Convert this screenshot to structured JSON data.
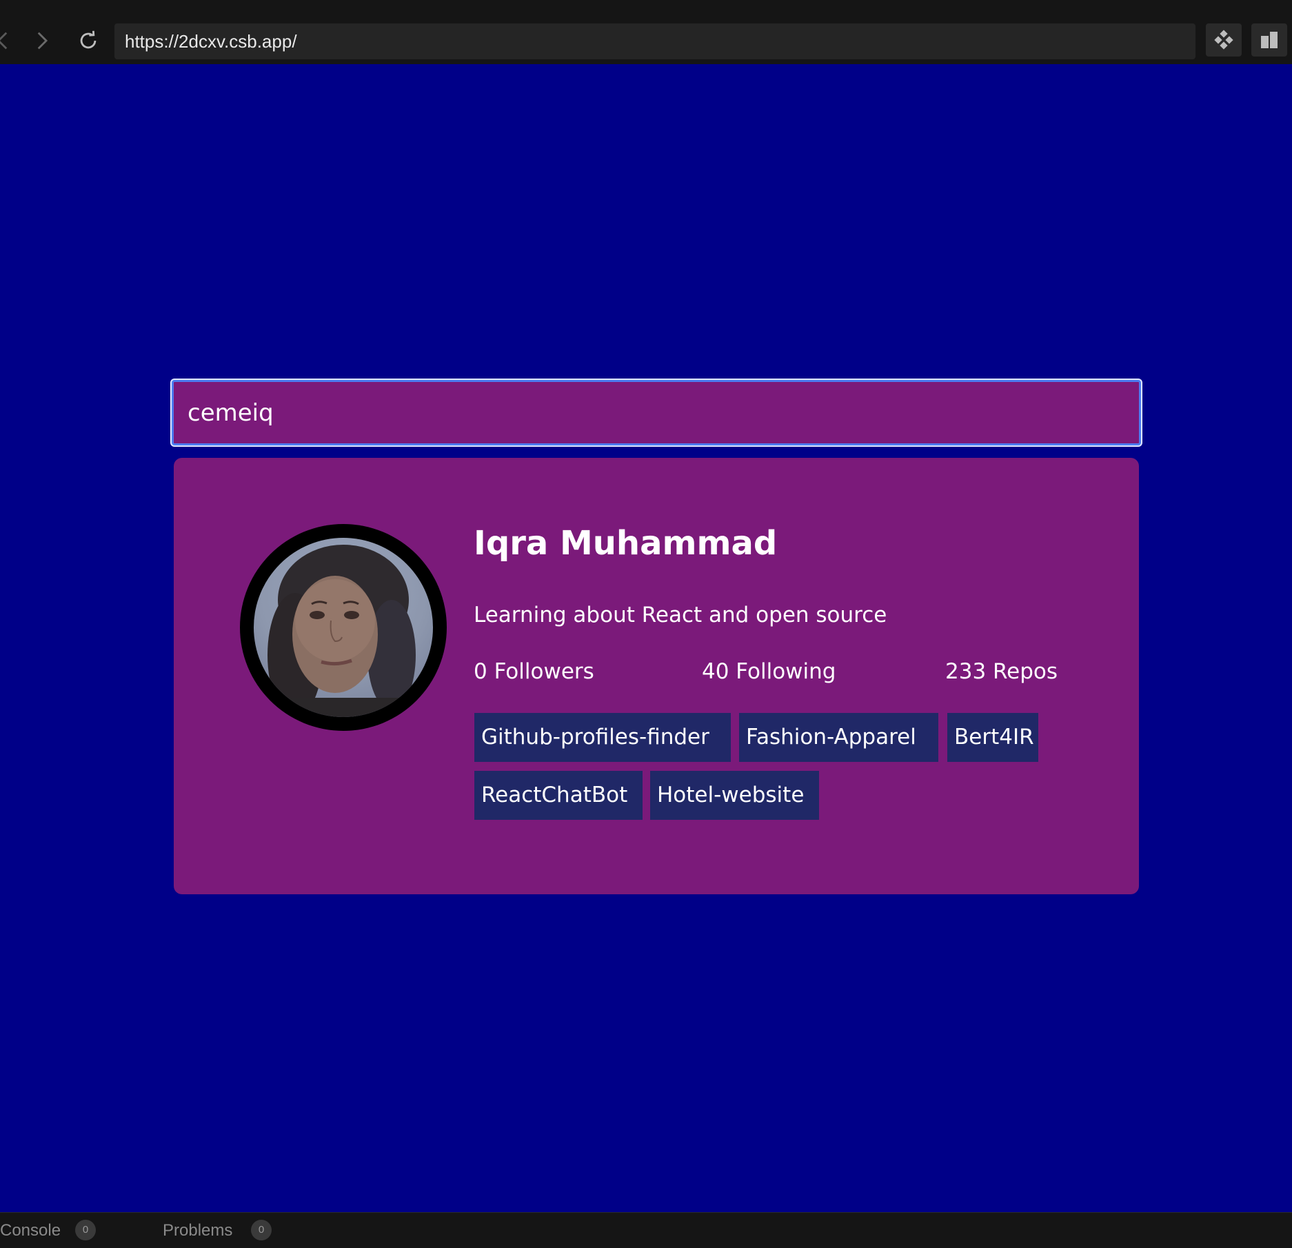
{
  "browser": {
    "url": "https://2dcxv.csb.app/",
    "back_icon": "chevron-left-icon",
    "forward_icon": "chevron-right-icon",
    "reload_icon": "reload-icon"
  },
  "search": {
    "value": "cemeiq"
  },
  "profile": {
    "name": "Iqra Muhammad",
    "bio": "Learning about React and open source",
    "followers": "0 Followers",
    "following": "40 Following",
    "repos": "233 Repos",
    "repo_list": [
      "Github-profiles-finder",
      "Fashion-Apparel",
      "Bert4IR",
      "ReactChatBot",
      "Hotel-website"
    ]
  },
  "devtools": {
    "console_label": "Console",
    "console_count": "0",
    "problems_label": "Problems",
    "problems_count": "0"
  },
  "colors": {
    "page_background": "#000088",
    "card_background": "#7b1a7a",
    "repo_tag_background": "#202867",
    "chrome_background": "#151515"
  }
}
